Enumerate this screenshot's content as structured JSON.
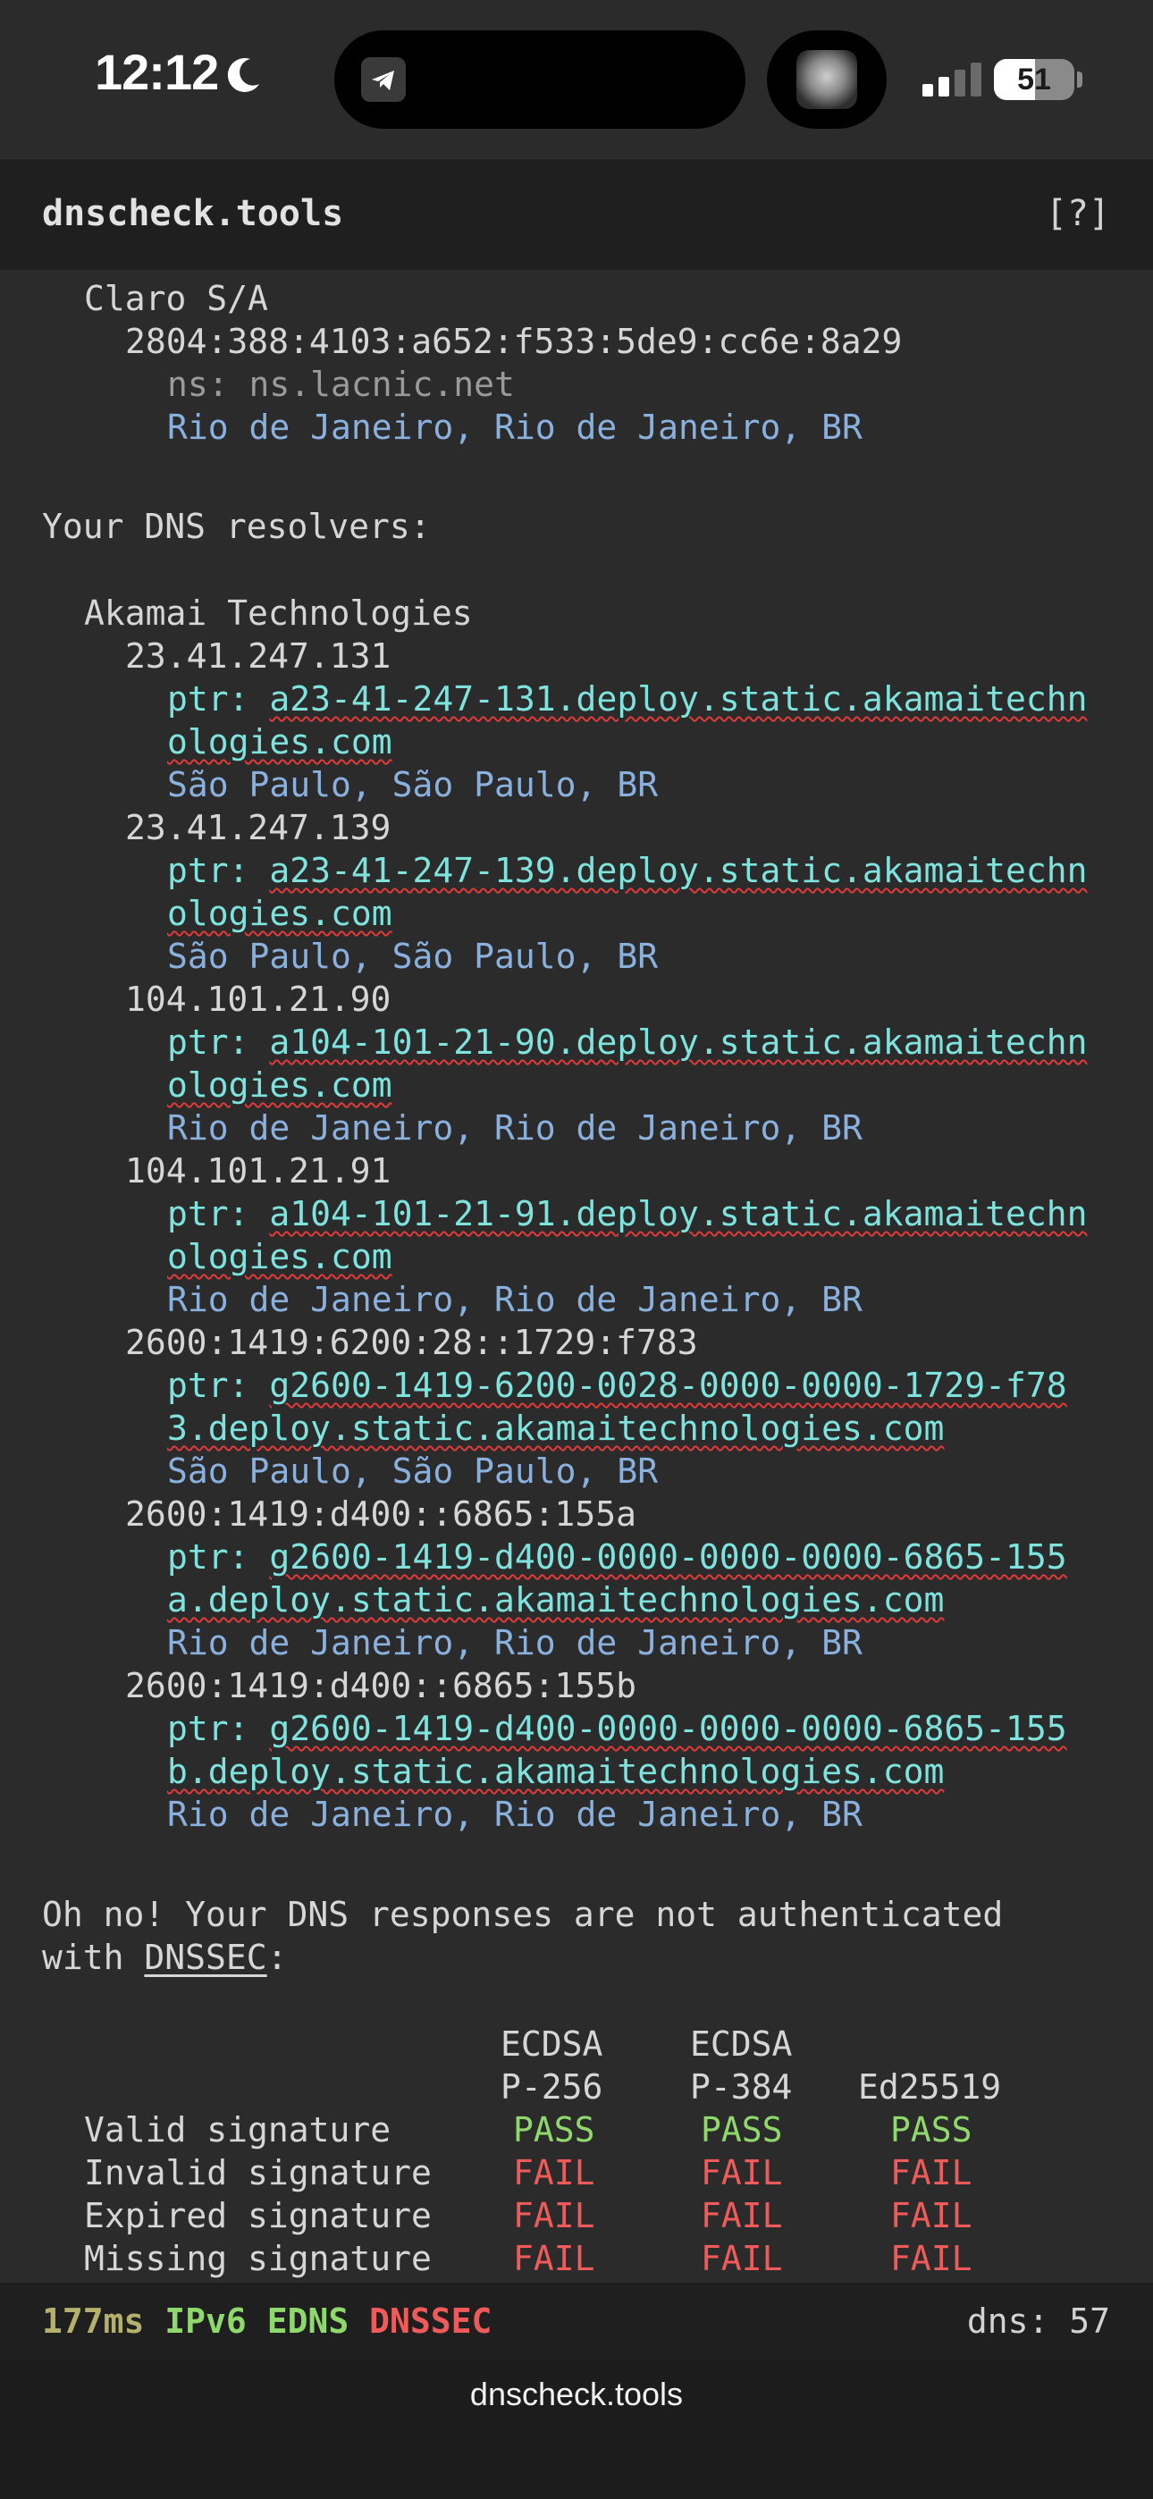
{
  "status": {
    "time": "12:12",
    "battery": "51",
    "icons": [
      "moon-icon",
      "telegram-icon",
      "album-art",
      "signal-icon",
      "battery-icon"
    ]
  },
  "header": {
    "title": "dnscheck.tools",
    "help": "[?]"
  },
  "isp": {
    "name": "Claro S/A",
    "ip": "2804:388:4103:a652:f533:5de9:cc6e:8a29",
    "ns": "ns: ns.lacnic.net",
    "location": "Rio de Janeiro, Rio de Janeiro, BR"
  },
  "resolvers": {
    "heading": "Your DNS resolvers:",
    "org": "Akamai Technologies",
    "ptr_label": "ptr: ",
    "items": [
      {
        "ip": "23.41.247.131",
        "ptr1": "a23-41-247-131.deploy.static.akamaitechn",
        "ptr2": "ologies.com",
        "loc": "São Paulo, São Paulo, BR"
      },
      {
        "ip": "23.41.247.139",
        "ptr1": "a23-41-247-139.deploy.static.akamaitechn",
        "ptr2": "ologies.com",
        "loc": "São Paulo, São Paulo, BR"
      },
      {
        "ip": "104.101.21.90",
        "ptr1": "a104-101-21-90.deploy.static.akamaitechn",
        "ptr2": "ologies.com",
        "loc": "Rio de Janeiro, Rio de Janeiro, BR"
      },
      {
        "ip": "104.101.21.91",
        "ptr1": "a104-101-21-91.deploy.static.akamaitechn",
        "ptr2": "ologies.com",
        "loc": "Rio de Janeiro, Rio de Janeiro, BR"
      },
      {
        "ip": "2600:1419:6200:28::1729:f783",
        "ptr1": "g2600-1419-6200-0028-0000-0000-1729-f78",
        "ptr2": "3.deploy.static.akamaitechnologies.com",
        "loc": "São Paulo, São Paulo, BR"
      },
      {
        "ip": "2600:1419:d400::6865:155a",
        "ptr1": "g2600-1419-d400-0000-0000-0000-6865-155",
        "ptr2": "a.deploy.static.akamaitechnologies.com",
        "loc": "Rio de Janeiro, Rio de Janeiro, BR"
      },
      {
        "ip": "2600:1419:d400::6865:155b",
        "ptr1": "g2600-1419-d400-0000-0000-0000-6865-155",
        "ptr2": "b.deploy.static.akamaitechnologies.com",
        "loc": "Rio de Janeiro, Rio de Janeiro, BR"
      }
    ]
  },
  "dnssec": {
    "line1": "Oh no! Your DNS responses are not authenticated",
    "line2_prefix": "with ",
    "link": "DNSSEC",
    "line2_suffix": ":",
    "columns": [
      {
        "top": "ECDSA",
        "bottom": "P-256"
      },
      {
        "top": "ECDSA",
        "bottom": "P-384"
      },
      {
        "top": "",
        "bottom": "Ed25519"
      }
    ],
    "rows": [
      {
        "label": "Valid signature",
        "results": [
          "PASS",
          "PASS",
          "PASS"
        ]
      },
      {
        "label": "Invalid signature",
        "results": [
          "FAIL",
          "FAIL",
          "FAIL"
        ]
      },
      {
        "label": "Expired signature",
        "results": [
          "FAIL",
          "FAIL",
          "FAIL"
        ]
      },
      {
        "label": "Missing signature",
        "results": [
          "FAIL",
          "FAIL",
          "FAIL"
        ]
      }
    ],
    "colors": {
      "pass": "#8fd86b",
      "fail": "#ef5a5a"
    }
  },
  "footer": {
    "latency": "177ms",
    "ipv6": "IPv6",
    "edns": "EDNS",
    "dnssec": "DNSSEC",
    "dns_count": "dns: 57"
  },
  "browser": {
    "url": "dnscheck.tools"
  }
}
